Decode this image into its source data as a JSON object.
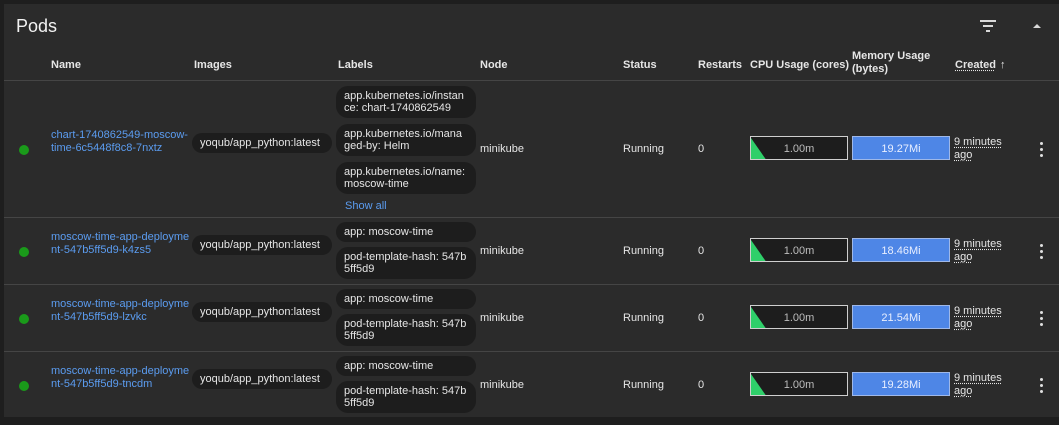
{
  "card": {
    "title": "Pods",
    "filter_icon": "filter-icon",
    "collapse_icon": "chevron-up-icon"
  },
  "columns": {
    "name": "Name",
    "images": "Images",
    "labels": "Labels",
    "node": "Node",
    "status": "Status",
    "restarts": "Restarts",
    "cpu": "CPU Usage (cores)",
    "memory": "Memory Usage (bytes)",
    "created": "Created",
    "sort_icon": "arrow-up-icon"
  },
  "colors": {
    "status_running": "#1a9a1a",
    "link": "#5b9cf0",
    "cpu_spark": "#2fcf6a",
    "memory_bar": "#4e86e6"
  },
  "pods": [
    {
      "name": "chart-1740862549-moscow-time-6c5448f8c8-7nxtz",
      "image": "yoqub/app_python:latest",
      "labels": [
        "app.kubernetes.io/instance: chart-1740862549",
        "app.kubernetes.io/managed-by: Helm",
        "app.kubernetes.io/name: moscow-time"
      ],
      "show_all": "Show all",
      "node": "minikube",
      "status": "Running",
      "restarts": "0",
      "cpu": "1.00m",
      "memory": "19.27Mi",
      "created": "9 minutes ago"
    },
    {
      "name": "moscow-time-app-deployment-547b5ff5d9-k4zs5",
      "image": "yoqub/app_python:latest",
      "labels": [
        "app: moscow-time",
        "pod-template-hash: 547b5ff5d9"
      ],
      "node": "minikube",
      "status": "Running",
      "restarts": "0",
      "cpu": "1.00m",
      "memory": "18.46Mi",
      "created": "9 minutes ago"
    },
    {
      "name": "moscow-time-app-deployment-547b5ff5d9-lzvkc",
      "image": "yoqub/app_python:latest",
      "labels": [
        "app: moscow-time",
        "pod-template-hash: 547b5ff5d9"
      ],
      "node": "minikube",
      "status": "Running",
      "restarts": "0",
      "cpu": "1.00m",
      "memory": "21.54Mi",
      "created": "9 minutes ago"
    },
    {
      "name": "moscow-time-app-deployment-547b5ff5d9-tncdm",
      "image": "yoqub/app_python:latest",
      "labels": [
        "app: moscow-time",
        "pod-template-hash: 547b5ff5d9"
      ],
      "node": "minikube",
      "status": "Running",
      "restarts": "0",
      "cpu": "1.00m",
      "memory": "19.28Mi",
      "created": "9 minutes ago"
    }
  ]
}
